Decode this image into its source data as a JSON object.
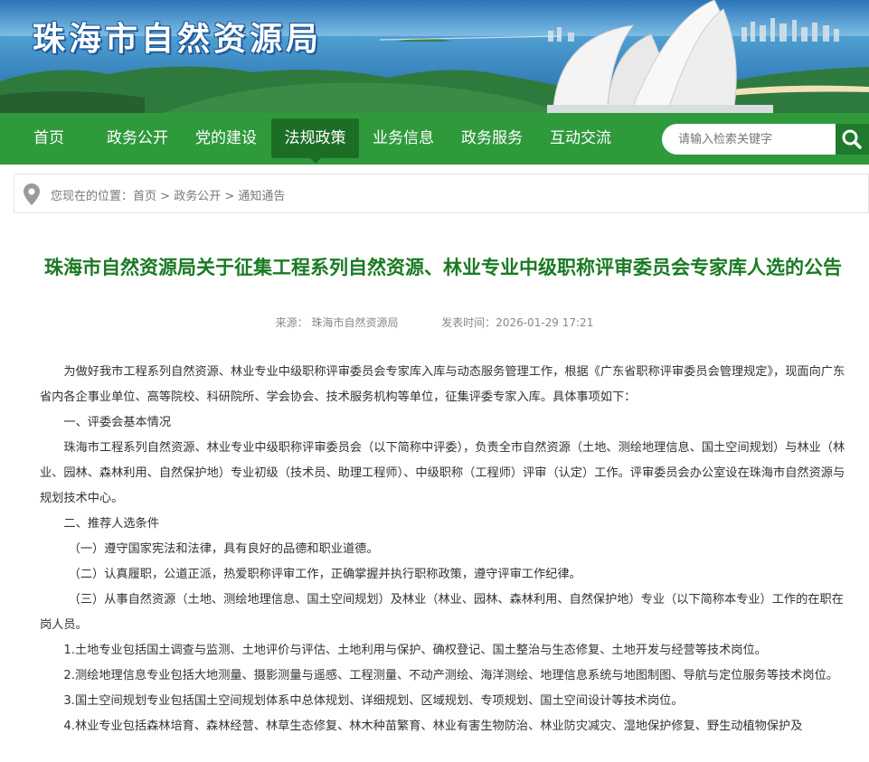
{
  "site": {
    "title": "珠海市自然资源局"
  },
  "nav": {
    "items": [
      {
        "label": "首页",
        "active": false
      },
      {
        "label": "政务公开",
        "active": false
      },
      {
        "label": "党的建设",
        "active": false
      },
      {
        "label": "法规政策",
        "active": true
      },
      {
        "label": "业务信息",
        "active": false
      },
      {
        "label": "政务服务",
        "active": false
      },
      {
        "label": "互动交流",
        "active": false
      }
    ],
    "search_placeholder": "请输入检索关键字",
    "search_icon": "magnifier-icon"
  },
  "breadcrumb": {
    "prefix": "您现在的位置：",
    "items": [
      "首页",
      "政务公开",
      "通知通告"
    ],
    "separator": ">",
    "icon": "location-pin-icon"
  },
  "article": {
    "title": "珠海市自然资源局关于征集工程系列自然资源、林业专业中级职称评审委员会专家库人选的公告",
    "source_label": "来源：",
    "source": "珠海市自然资源局",
    "time_label": "发表时间：",
    "time": "2026-01-29 17:21",
    "paragraphs": [
      "为做好我市工程系列自然资源、林业专业中级职称评审委员会专家库入库与动态服务管理工作，根据《广东省职称评审委员会管理规定》，现面向广东省内各企事业单位、高等院校、科研院所、学会协会、技术服务机构等单位，征集评委专家入库。具体事项如下：",
      "一、评委会基本情况",
      "珠海市工程系列自然资源、林业专业中级职称评审委员会（以下简称中评委），负责全市自然资源（土地、测绘地理信息、国土空间规划）与林业（林业、园林、森林利用、自然保护地）专业初级（技术员、助理工程师）、中级职称（工程师）评审（认定）工作。评审委员会办公室设在珠海市自然资源与规划技术中心。",
      "二、推荐人选条件",
      "（一）遵守国家宪法和法律，具有良好的品德和职业道德。",
      "（二）认真履职，公道正派，热爱职称评审工作，正确掌握并执行职称政策，遵守评审工作纪律。",
      "（三）从事自然资源（土地、测绘地理信息、国土空间规划）及林业（林业、园林、森林利用、自然保护地）专业（以下简称本专业）工作的在职在岗人员。",
      "1.土地专业包括国土调查与监测、土地评价与评估、土地利用与保护、确权登记、国土整治与生态修复、土地开发与经营等技术岗位。",
      "2.测绘地理信息专业包括大地测量、摄影测量与遥感、工程测量、不动产测绘、海洋测绘、地理信息系统与地图制图、导航与定位服务等技术岗位。",
      "3.国土空间规划专业包括国土空间规划体系中总体规划、详细规划、区域规划、专项规划、国土空间设计等技术岗位。",
      "4.林业专业包括森林培育、森林经营、林草生态修复、林木种苗繁育、林业有害生物防治、林业防灾减灾、湿地保护修复、野生动植物保护及"
    ]
  }
}
